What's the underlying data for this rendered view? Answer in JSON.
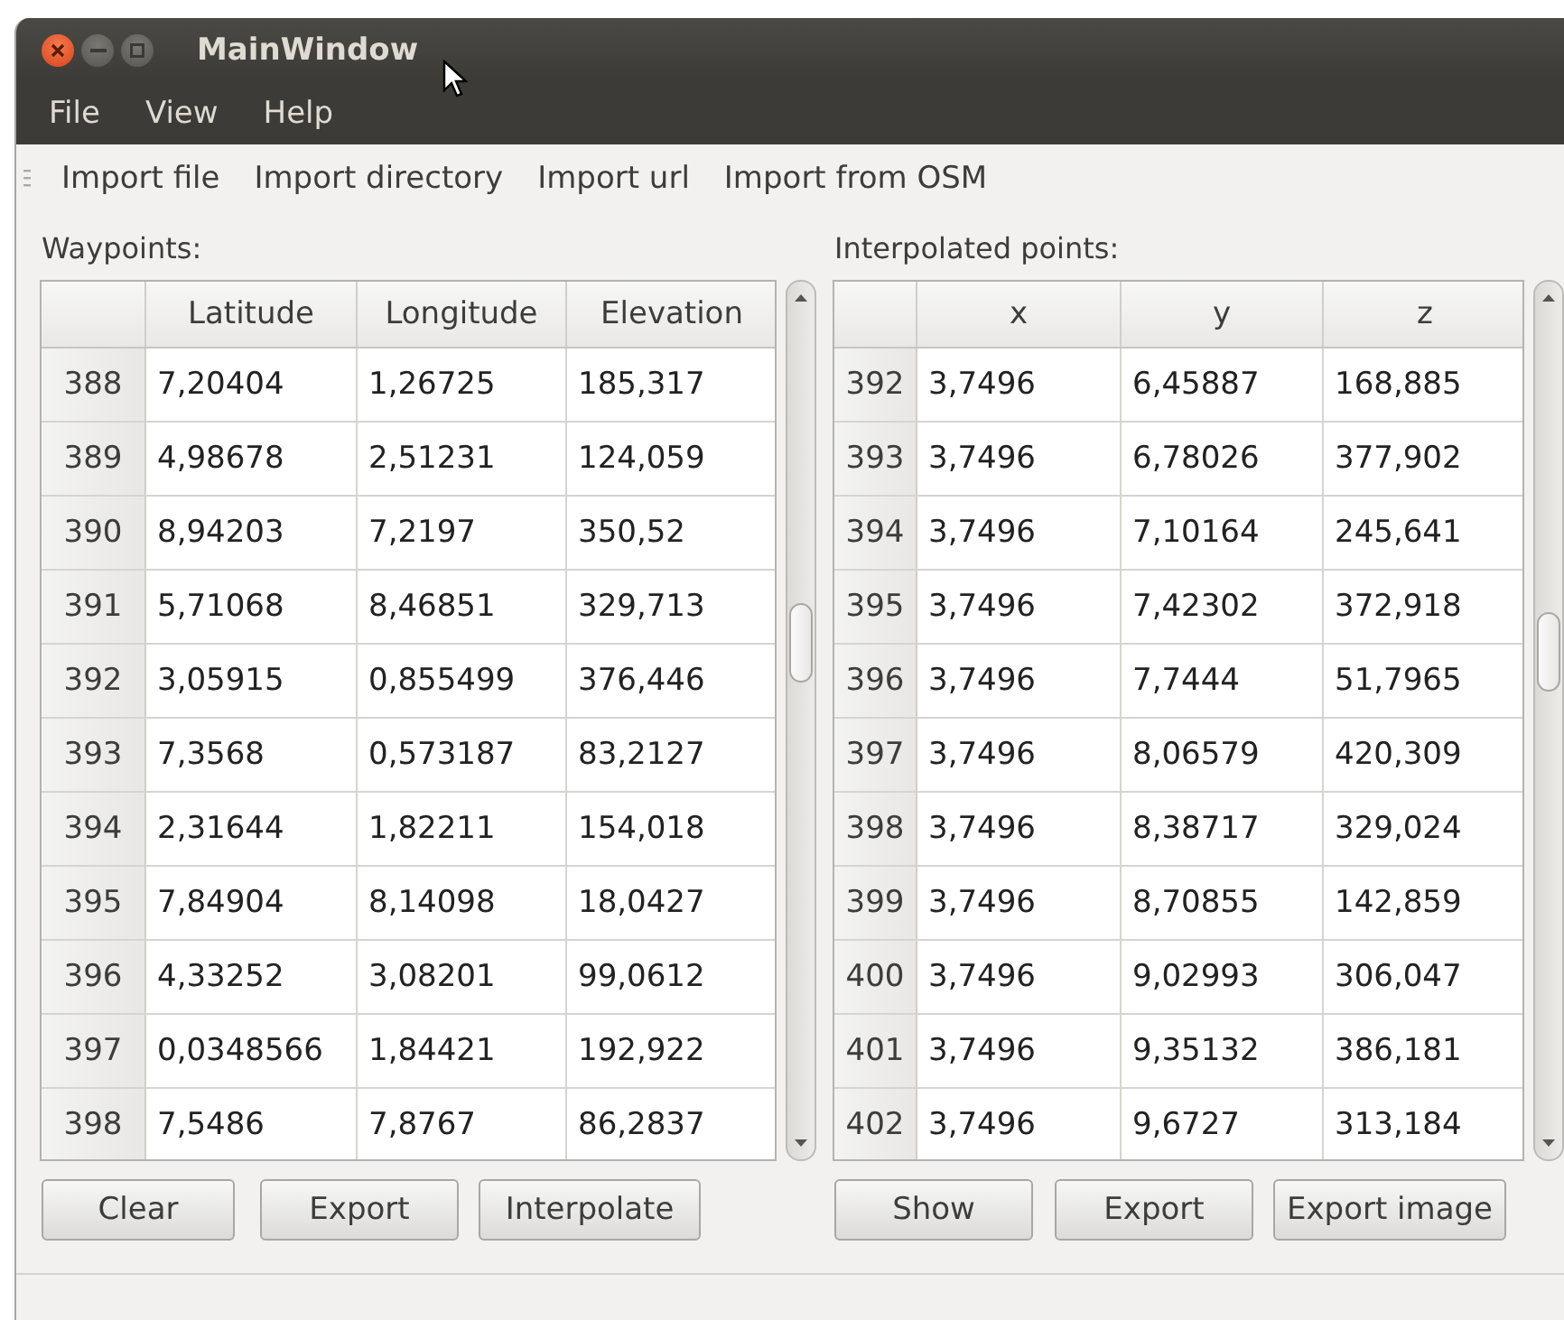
{
  "window": {
    "title": "MainWindow"
  },
  "menu_bar": [
    "File",
    "View",
    "Help"
  ],
  "toolbar": [
    "Import file",
    "Import directory",
    "Import url",
    "Import from OSM"
  ],
  "panels": [
    {
      "label": "Waypoints:",
      "columns": [
        "Latitude",
        "Longitude",
        "Elevation"
      ],
      "rows": [
        {
          "header": "388",
          "cells": [
            "7,20404",
            "1,26725",
            "185,317"
          ]
        },
        {
          "header": "389",
          "cells": [
            "4,98678",
            "2,51231",
            "124,059"
          ]
        },
        {
          "header": "390",
          "cells": [
            "8,94203",
            "7,2197",
            "350,52"
          ]
        },
        {
          "header": "391",
          "cells": [
            "5,71068",
            "8,46851",
            "329,713"
          ]
        },
        {
          "header": "392",
          "cells": [
            "3,05915",
            "0,855499",
            "376,446"
          ]
        },
        {
          "header": "393",
          "cells": [
            "7,3568",
            "0,573187",
            "83,2127"
          ]
        },
        {
          "header": "394",
          "cells": [
            "2,31644",
            "1,82211",
            "154,018"
          ]
        },
        {
          "header": "395",
          "cells": [
            "7,84904",
            "8,14098",
            "18,0427"
          ]
        },
        {
          "header": "396",
          "cells": [
            "4,33252",
            "3,08201",
            "99,0612"
          ]
        },
        {
          "header": "397",
          "cells": [
            "0,0348566",
            "1,84421",
            "192,922"
          ]
        },
        {
          "header": "398",
          "cells": [
            "7,5486",
            "7,8767",
            "86,2837"
          ]
        }
      ],
      "buttons": [
        "Clear",
        "Export",
        "Interpolate"
      ]
    },
    {
      "label": "Interpolated points:",
      "columns": [
        "x",
        "y",
        "z"
      ],
      "rows": [
        {
          "header": "392",
          "cells": [
            "3,7496",
            "6,45887",
            "168,885"
          ]
        },
        {
          "header": "393",
          "cells": [
            "3,7496",
            "6,78026",
            "377,902"
          ]
        },
        {
          "header": "394",
          "cells": [
            "3,7496",
            "7,10164",
            "245,641"
          ]
        },
        {
          "header": "395",
          "cells": [
            "3,7496",
            "7,42302",
            "372,918"
          ]
        },
        {
          "header": "396",
          "cells": [
            "3,7496",
            "7,7444",
            "51,7965"
          ]
        },
        {
          "header": "397",
          "cells": [
            "3,7496",
            "8,06579",
            "420,309"
          ]
        },
        {
          "header": "398",
          "cells": [
            "3,7496",
            "8,38717",
            "329,024"
          ]
        },
        {
          "header": "399",
          "cells": [
            "3,7496",
            "8,70855",
            "142,859"
          ]
        },
        {
          "header": "400",
          "cells": [
            "3,7496",
            "9,02993",
            "306,047"
          ]
        },
        {
          "header": "401",
          "cells": [
            "3,7496",
            "9,35132",
            "386,181"
          ]
        },
        {
          "header": "402",
          "cells": [
            "3,7496",
            "9,6727",
            "313,184"
          ]
        }
      ],
      "buttons": [
        "Show",
        "Export",
        "Export image"
      ]
    }
  ]
}
